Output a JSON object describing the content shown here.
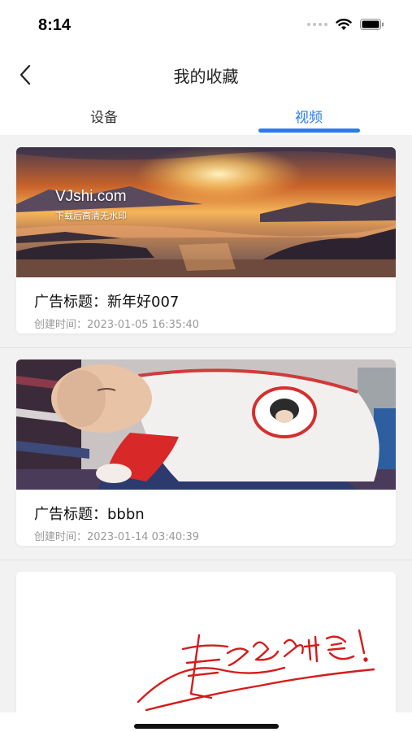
{
  "status_bar": {
    "time": "8:14"
  },
  "header": {
    "title": "我的收藏"
  },
  "tabs": [
    {
      "label": "设备",
      "active": false
    },
    {
      "label": "视频",
      "active": true
    }
  ],
  "accent_color": "#2a7bf0",
  "items": [
    {
      "title": "广告标题：新年好007",
      "created": "创建时间：2023-01-05 16:35:40",
      "thumbnail": "sunset-lake-landscape",
      "watermark": "VJshi.com",
      "watermark_sub": "下载后高清无水印"
    },
    {
      "title": "广告标题：bbbn",
      "created": "创建时间：2023-01-14 03:40:39",
      "thumbnail": "sleeping-baby-photo"
    },
    {
      "thumbnail": "red-calligraphy-signature"
    }
  ]
}
